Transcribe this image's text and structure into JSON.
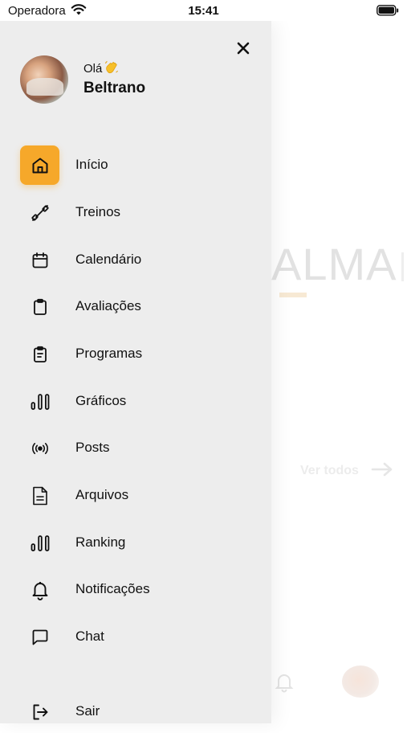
{
  "status_bar": {
    "carrier": "Operadora",
    "time": "15:41",
    "wifi_icon": "wifi-icon",
    "battery_icon": "battery-icon"
  },
  "drawer": {
    "close_icon": "close-icon",
    "greeting": "Olá",
    "greeting_emoji": "waving-hand-icon",
    "user_name": "Beltrano",
    "active_color": "#f6a82a",
    "menu": [
      {
        "label": "Início",
        "icon": "home-icon",
        "active": true
      },
      {
        "label": "Treinos",
        "icon": "dumbbell-icon",
        "active": false
      },
      {
        "label": "Calendário",
        "icon": "calendar-icon",
        "active": false
      },
      {
        "label": "Avaliações",
        "icon": "clipboard-icon",
        "active": false
      },
      {
        "label": "Programas",
        "icon": "clipboard-list-icon",
        "active": false
      },
      {
        "label": "Gráficos",
        "icon": "bar-chart-icon",
        "active": false
      },
      {
        "label": "Posts",
        "icon": "broadcast-icon",
        "active": false
      },
      {
        "label": "Arquivos",
        "icon": "file-icon",
        "active": false
      },
      {
        "label": "Ranking",
        "icon": "ranking-icon",
        "active": false
      },
      {
        "label": "Notificações",
        "icon": "bell-icon",
        "active": false
      },
      {
        "label": "Chat",
        "icon": "chat-icon",
        "active": false
      }
    ],
    "logout": {
      "label": "Sair",
      "icon": "logout-icon"
    }
  },
  "background": {
    "logo_text": "ALMA",
    "see_all": "Ver todos"
  }
}
